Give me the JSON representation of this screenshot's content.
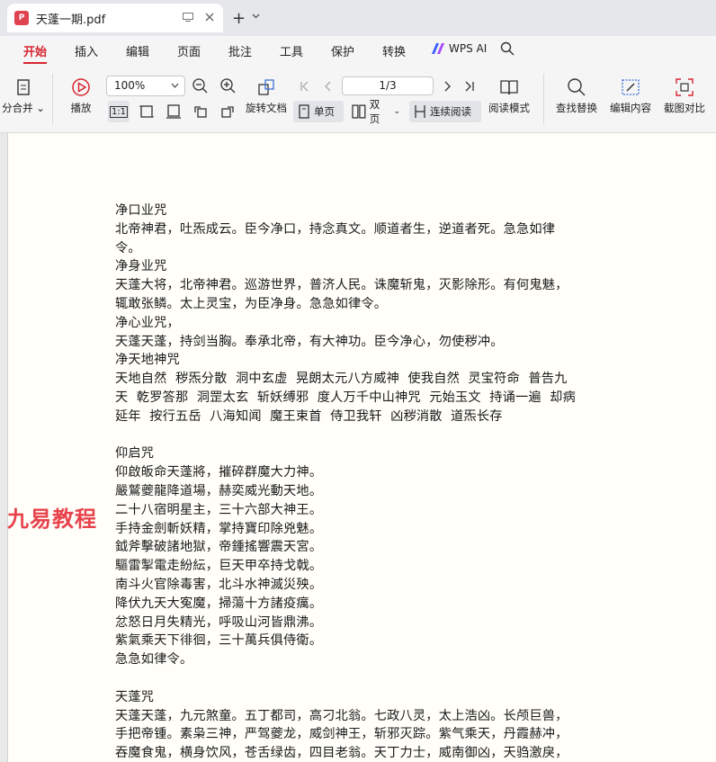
{
  "titlebar": {
    "tab_title": "天蓬一期.pdf",
    "pdf_icon_glyph": "P",
    "new_tab_glyph": "+"
  },
  "menu": {
    "items": [
      "开始",
      "插入",
      "编辑",
      "页面",
      "批注",
      "工具",
      "保护",
      "转换"
    ],
    "active": "开始",
    "wps_ai": "WPS AI",
    "accent_color": "#d7262f"
  },
  "toolbar": {
    "split_merge": "分合并",
    "play": "播放",
    "zoom": "100%",
    "rotate": "旋转文档",
    "single_page": "单页",
    "double_page": "双页",
    "continuous": "连续阅读",
    "page_indicator": "1/3",
    "read_mode": "阅读模式",
    "find_replace": "查找替换",
    "edit_content": "编辑内容",
    "screenshot_compare": "截图对比",
    "actual_size": "1:1"
  },
  "watermark": "九易教程",
  "document": {
    "lines": [
      "净口业咒",
      "北帝神君，吐炁成云。臣今净口，持念真文。顺道者生，逆道者死。急急如律",
      "令。",
      "净身业咒",
      "天蓬大将，北帝神君。巡游世界，普济人民。诛魔斩鬼，灭影除形。有何鬼魅，",
      "辄敢张鳞。太上灵宝，为臣净身。急急如律令。",
      "净心业咒，",
      "天蓬天蓬，持剑当胸。奉承北帝，有大神功。臣今净心，勿使秽冲。",
      "净天地神咒",
      "天地自然  秽炁分散  洞中玄虚  晃朗太元八方威神  使我自然  灵宝符命  普告九",
      "天  乾罗答那  洞罡太玄  斩妖缚邪  度人万千中山神咒  元始玉文  持诵一遍  却病",
      "延年  按行五岳  八海知闻  魔王束首  侍卫我轩  凶秽消散  道炁长存",
      "",
      "仰启咒",
      "仰啟皈命天蓬將，摧碎群魔大力神。",
      "嚴鷲夔龍降道場，赫奕威光動天地。",
      "二十八宿明星主，三十六部大神王。",
      "手持金劍斬妖精，掌持寶印除兇魅。",
      "鉞斧擊破諸地獄，帝鍾搖響震天宮。",
      "驅雷掣電走紛紜，巨天甲卒持戈戟。",
      "南斗火官除毒害，北斗水神滅災殃。",
      "降伏九天大寃魔，掃蕩十方諸疫癘。",
      "忿怒日月失精光，呼吸山河皆鼎沸。",
      "紫氣乘天下徘徊，三十萬兵俱侍衛。",
      "急急如律令。",
      "",
      "天蓬咒",
      "天蓬天蓬，九元煞童。五丁都司，高刁北翁。七政八灵，太上浩凶。长颅巨兽，",
      "手把帝锺。素枭三神，严驾夔龙，威剑神王，斩邪灭踪。紫气乘天，丹霞赫冲，",
      "吞魔食鬼，横身饮风，苍舌绿齿，四目老翁。天丁力士，威南御凶，天驺激戾，"
    ]
  }
}
